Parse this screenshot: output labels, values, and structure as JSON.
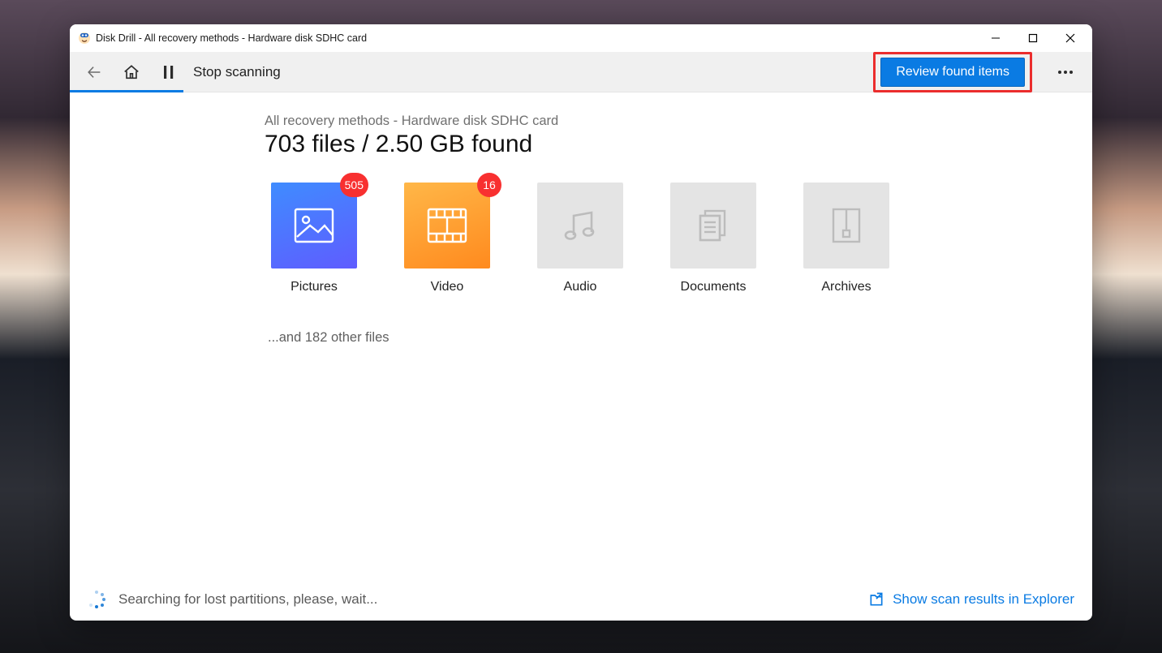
{
  "window": {
    "title": "Disk Drill - All recovery methods - Hardware disk SDHC card"
  },
  "toolbar": {
    "stop_label": "Stop scanning",
    "review_label": "Review found items"
  },
  "main": {
    "breadcrumb": "All recovery methods - Hardware disk SDHC card",
    "headline": "703 files / 2.50 GB found",
    "other_files": "...and 182 other files",
    "categories": {
      "pictures": {
        "label": "Pictures",
        "badge": "505"
      },
      "video": {
        "label": "Video",
        "badge": "16"
      },
      "audio": {
        "label": "Audio"
      },
      "documents": {
        "label": "Documents"
      },
      "archives": {
        "label": "Archives"
      }
    }
  },
  "status": {
    "text": "Searching for lost partitions, please, wait...",
    "explorer_link": "Show scan results in Explorer"
  }
}
